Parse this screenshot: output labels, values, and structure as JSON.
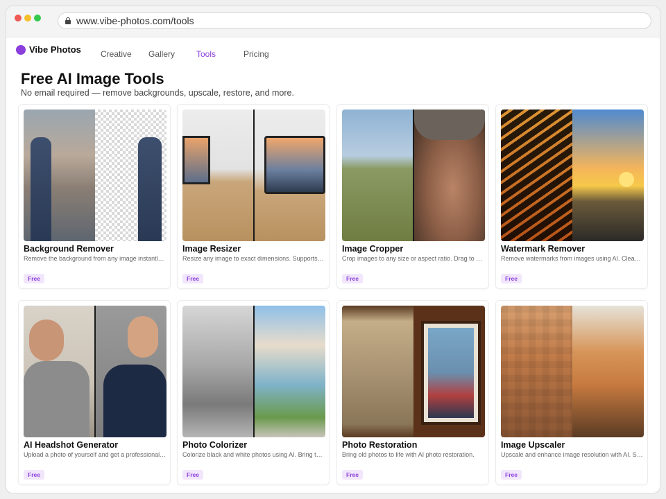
{
  "browser": {
    "url": "www.vibe-photos.com/tools"
  },
  "nav": {
    "brand": "Vibe Photos",
    "links": [
      "Creative",
      "Gallery",
      "Tools",
      "Pricing"
    ],
    "active": "Tools"
  },
  "colors": {
    "accent": "#8b3fdc",
    "badge_bg": "#f1e6fb"
  },
  "page": {
    "title": "Free AI Image Tools",
    "subtitle": "No email required — remove backgrounds, upscale, restore, and more."
  },
  "tools": [
    {
      "title": "Background Remover",
      "desc": "Remove the background from any image instantly with AI.",
      "badge": "Free"
    },
    {
      "title": "Image Resizer",
      "desc": "Resize any image to exact dimensions. Supports all formats.",
      "badge": "Free"
    },
    {
      "title": "Image Cropper",
      "desc": "Crop images to any size or aspect ratio. Drag to select.",
      "badge": "Free"
    },
    {
      "title": "Watermark Remover",
      "desc": "Remove watermarks from images using AI. Clean results.",
      "badge": "Free"
    },
    {
      "title": "AI Headshot Generator",
      "desc": "Upload a photo of yourself and get a professional headshot.",
      "badge": "Free"
    },
    {
      "title": "Photo Colorizer",
      "desc": "Colorize black and white photos using AI. Bring them to life.",
      "badge": "Free"
    },
    {
      "title": "Photo Restoration",
      "desc": "Bring old photos to life with AI photo restoration.",
      "badge": "Free"
    },
    {
      "title": "Image Upscaler",
      "desc": "Upscale and enhance image resolution with AI. Sharper detail.",
      "badge": "Free"
    }
  ]
}
